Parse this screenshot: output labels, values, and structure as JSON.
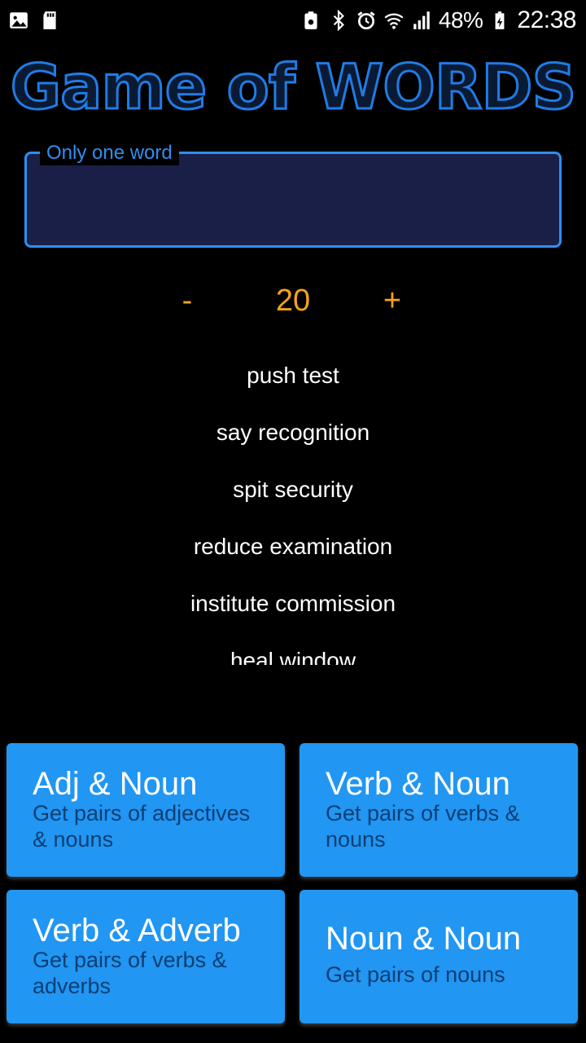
{
  "status_bar": {
    "battery": "48%",
    "time": "22:38",
    "icons_left": [
      "image-icon",
      "sd-card-icon"
    ],
    "icons_right": [
      "recycle-battery-icon",
      "bluetooth-icon",
      "alarm-icon",
      "wifi-icon",
      "signal-icon",
      "battery-icon"
    ]
  },
  "title": "Game of WORDS",
  "input": {
    "label": "Only one word",
    "value": ""
  },
  "stepper": {
    "minus": "-",
    "value": "20",
    "plus": "+"
  },
  "results": [
    "push test",
    "say recognition",
    "spit security",
    "reduce examination",
    "institute commission",
    "heal window"
  ],
  "categories": [
    {
      "title": "Adj & Noun",
      "subtitle": "Get pairs of adjectives & nouns"
    },
    {
      "title": "Verb & Noun",
      "subtitle": "Get pairs of verbs & nouns"
    },
    {
      "title": "Verb & Adverb",
      "subtitle": "Get pairs of verbs & adverbs"
    },
    {
      "title": "Noun & Noun",
      "subtitle": "Get pairs of nouns"
    }
  ],
  "colors": {
    "background": "#000000",
    "accent": "#2196f3",
    "stepper": "#f7a21b",
    "field_bg": "#1a1f47"
  }
}
